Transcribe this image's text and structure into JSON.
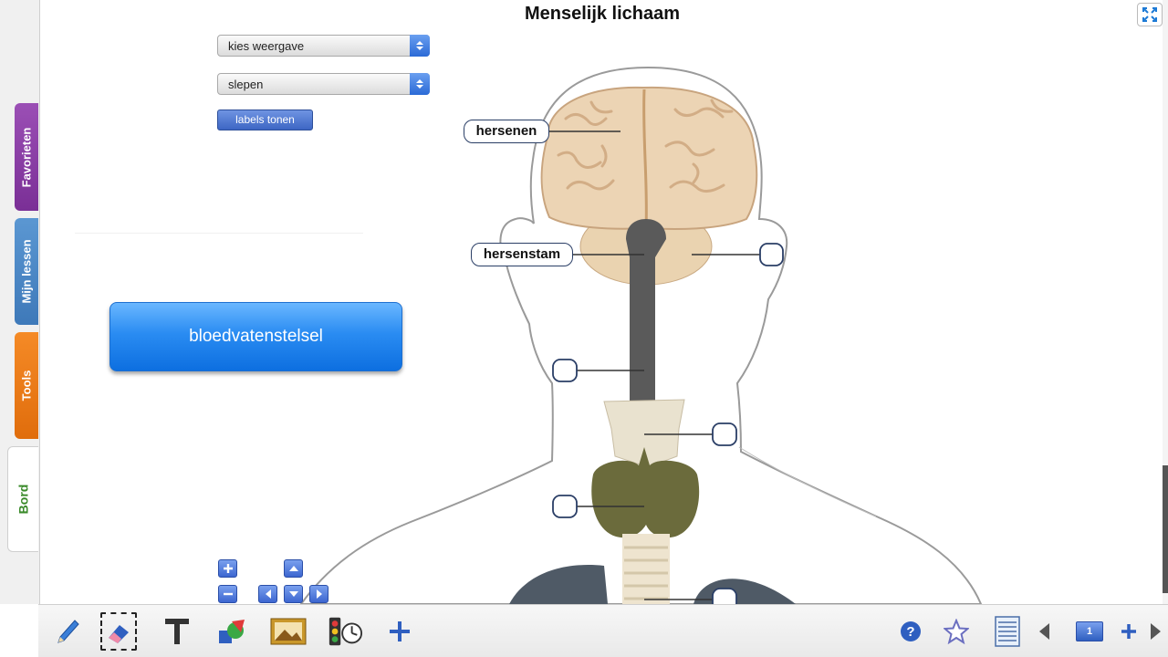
{
  "title": "Menselijk lichaam",
  "tabs": [
    {
      "id": "fav",
      "label": "Favorieten"
    },
    {
      "id": "lessons",
      "label": "Mijn lessen"
    },
    {
      "id": "tools",
      "label": "Tools"
    },
    {
      "id": "bord",
      "label": "Bord"
    }
  ],
  "controls": {
    "view_select": "kies weergave",
    "mode_select": "slepen",
    "labels_button": "labels tonen"
  },
  "system_button": "bloedvatenstelsel",
  "diagram_labels": {
    "brain": "hersenen",
    "brainstem": "hersenstam"
  },
  "toolbar": {
    "page_number": "1"
  },
  "colors": {
    "accent_blue": "#2a8cf2",
    "tab_favorites": "#8a3ea6",
    "tab_lessons": "#4a87c6",
    "tab_tools": "#f07a1a",
    "tab_bord_text": "#3a8a2a",
    "brain": "#ecd4b4",
    "thyroid": "#6b6b3c",
    "spinal_cord": "#5a5a5a"
  },
  "icons": [
    "pen-icon",
    "eraser-icon",
    "text-tool-icon",
    "shapes-icon",
    "image-icon",
    "timer-icon",
    "add-icon",
    "help-icon",
    "favorite-star-icon",
    "page-list-icon",
    "prev-page-icon",
    "page-icon",
    "add-page-icon",
    "next-page-icon",
    "fullscreen-icon"
  ]
}
